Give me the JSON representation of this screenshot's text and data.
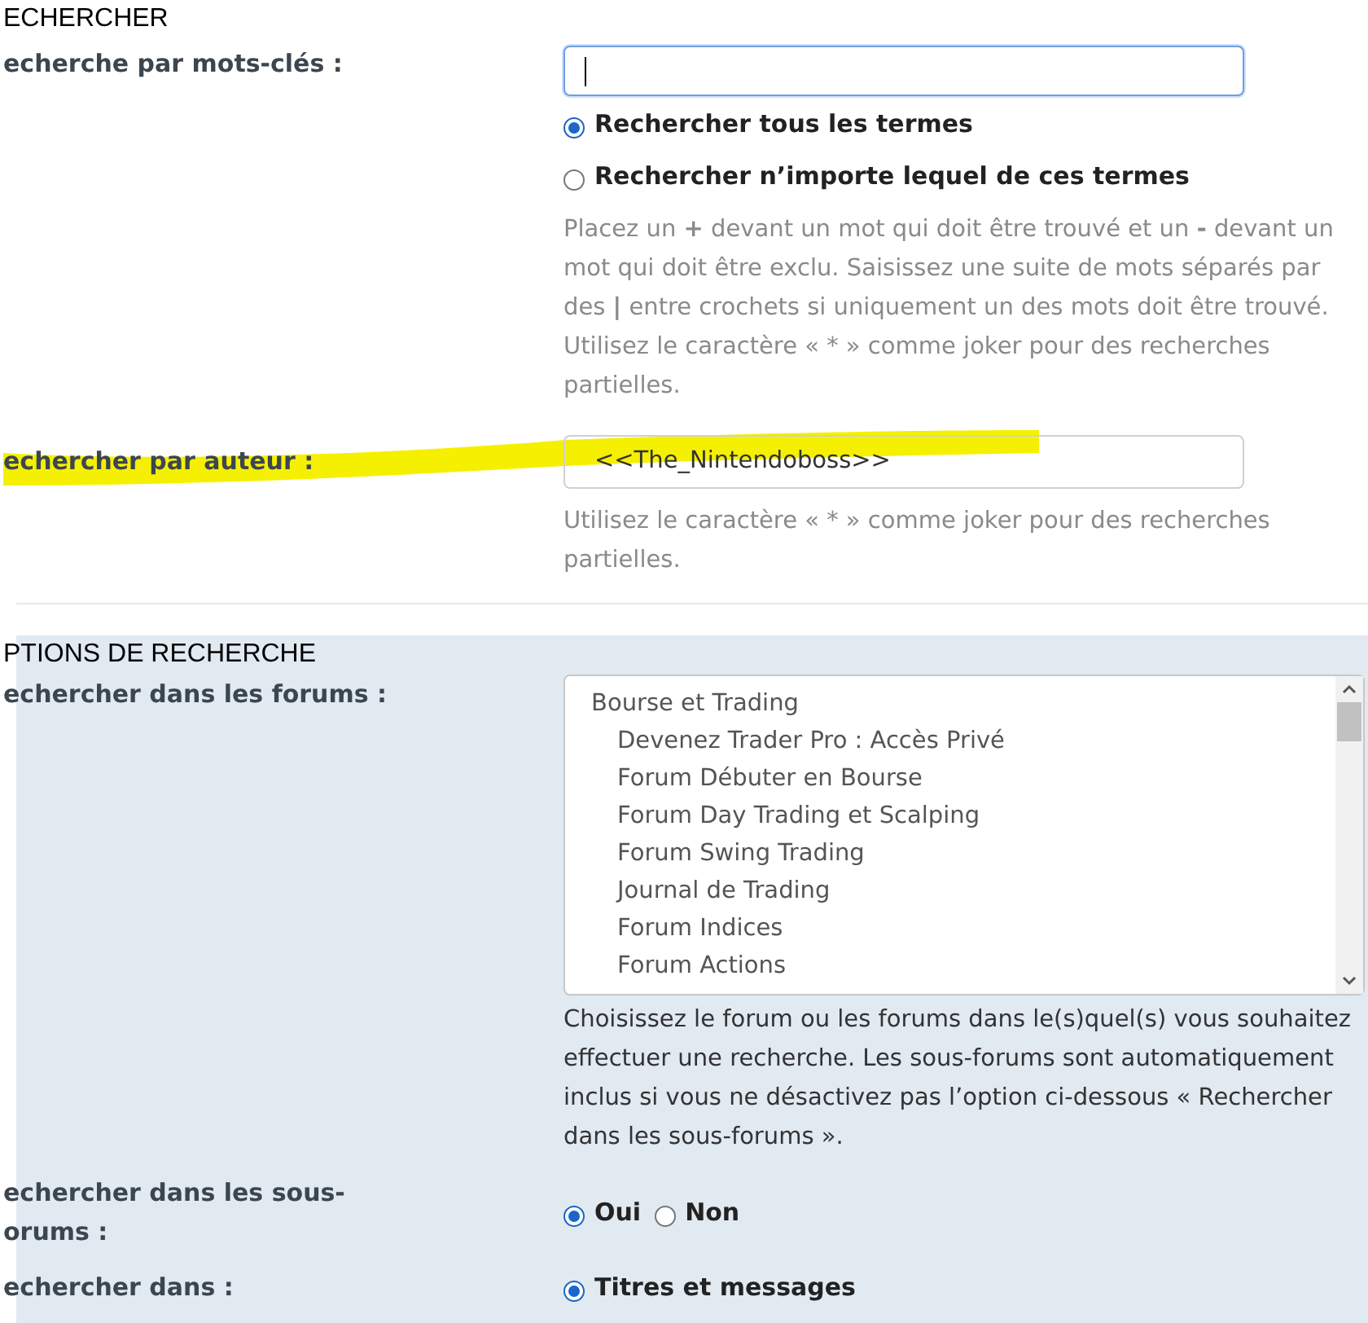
{
  "search_section": {
    "title": "ECHERCHER",
    "keywords": {
      "label": "echerche par mots-clés :",
      "focused": true,
      "options": [
        {
          "label": "Rechercher tous les termes",
          "selected": true
        },
        {
          "label": "Rechercher n’importe lequel de ces termes",
          "selected": false
        }
      ],
      "help": "Placez un **+** devant un mot qui doit être trouvé et un **-** devant un mot qui doit être exclu. Saisissez une suite de mots séparés par des **|** entre crochets si uniquement un des mots doit être trouvé. Utilisez le caractère « * » comme joker pour des recherches partielles."
    },
    "author": {
      "label": "echercher par auteur :",
      "value": "<<The_Nintendoboss>>",
      "highlighted": true,
      "help": "Utilisez le caractère « * » comme joker pour des recherches partielles."
    }
  },
  "options_section": {
    "title": "PTIONS DE RECHERCHE",
    "forums": {
      "label": "echercher dans les forums :",
      "items": [
        {
          "label": "Bourse et Trading",
          "children": [
            {
              "label": "Devenez Trader Pro : Accès Privé"
            },
            {
              "label": "Forum Débuter en Bourse"
            },
            {
              "label": "Forum Day Trading et Scalping"
            },
            {
              "label": "Forum Swing Trading"
            },
            {
              "label": "Journal de Trading"
            },
            {
              "label": "Forum Indices"
            },
            {
              "label": "Forum Actions"
            }
          ]
        }
      ],
      "help": "Choisissez le forum ou les forums dans le(s)quel(s) vous souhaitez effectuer une recherche. Les sous-forums sont automatiquement inclus si vous ne désactivez pas l’option ci-dessous « Rechercher dans les sous-forums »."
    },
    "subforums": {
      "label_lines": [
        "echercher dans les sous-",
        "orums :"
      ],
      "options": [
        {
          "label": "Oui",
          "selected": true
        },
        {
          "label": "Non",
          "selected": false
        }
      ]
    },
    "search_in": {
      "label": "echercher dans :",
      "options": [
        {
          "label": "Titres et messages",
          "selected": true
        }
      ]
    }
  }
}
